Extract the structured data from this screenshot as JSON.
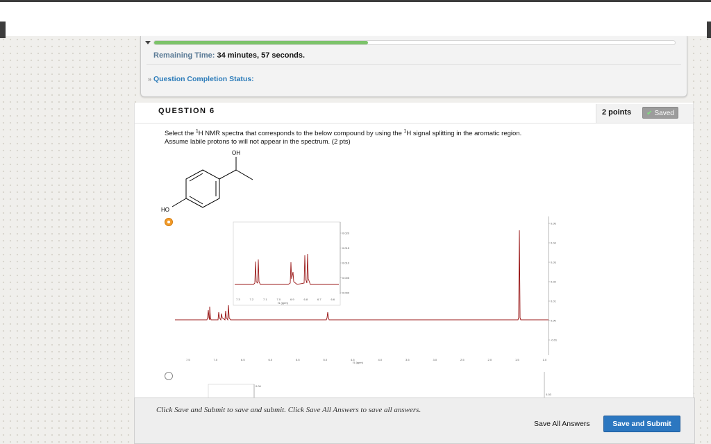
{
  "status": {
    "remaining_label": "Remaining Time:",
    "remaining_value": "34 minutes, 57 seconds.",
    "completion_label": "Question Completion Status:",
    "progress": 0.41
  },
  "question": {
    "title": "QUESTION 6",
    "points": "2 points",
    "saved_label": "Saved",
    "text_pre": "Select the ",
    "sup1": "1",
    "text_mid": "H NMR spectra that corresponds to the below compound by using the ",
    "sup2": "1",
    "text_post": "H signal splitting in the aromatic region.",
    "line2": "Assume labile protons to will not appear in the spectrum. (2 pts)",
    "molecule_labels": {
      "oh": "OH",
      "ho": "HO"
    }
  },
  "spectrum": {
    "inset_y_ticks": [
      "0.020",
      "0.015",
      "0.010",
      "0.005",
      "0.000"
    ],
    "inset_x_ticks": [
      "7.3",
      "7.2",
      "7.1",
      "7.0",
      "6.9",
      "6.8",
      "6.7",
      "6.6"
    ],
    "inset_x_label": "f1 (ppm)",
    "main_y_ticks": [
      "0.05",
      "0.04",
      "0.03",
      "0.02",
      "0.01",
      "0.00",
      "-0.01"
    ],
    "main_x_ticks": [
      "7.5",
      "7.0",
      "6.5",
      "6.0",
      "5.5",
      "5.0",
      "4.5",
      "4.0",
      "3.5",
      "3.0",
      "2.5",
      "2.0",
      "1.5",
      "1.0"
    ],
    "main_x_label": "f1 (ppm)",
    "option2_tick_left": "0.04",
    "option2_tick_right": "0.03"
  },
  "footer": {
    "message": "Click Save and Submit to save and submit. Click Save All Answers to save all answers.",
    "save_all": "Save All Answers",
    "save_submit": "Save and Submit"
  }
}
